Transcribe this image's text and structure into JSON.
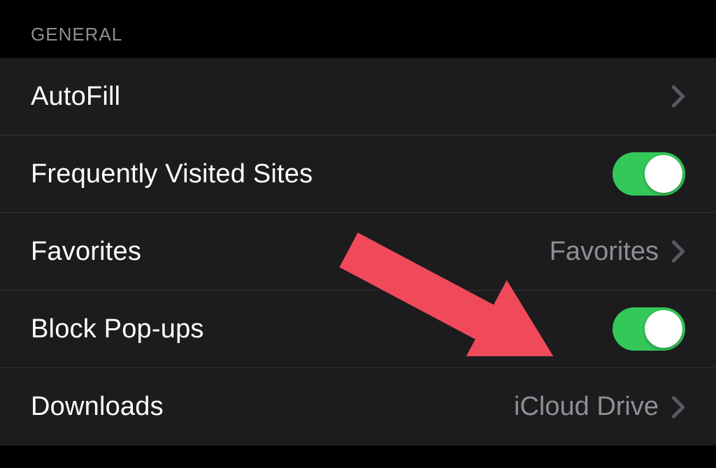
{
  "section": {
    "header": "General"
  },
  "rows": {
    "autofill": {
      "label": "AutoFill",
      "type": "nav"
    },
    "frequently_visited": {
      "label": "Frequently Visited Sites",
      "type": "toggle",
      "toggle_on": true
    },
    "favorites": {
      "label": "Favorites",
      "type": "nav",
      "value": "Favorites"
    },
    "block_popups": {
      "label": "Block Pop-ups",
      "type": "toggle",
      "toggle_on": true
    },
    "downloads": {
      "label": "Downloads",
      "type": "nav",
      "value": "iCloud Drive"
    }
  },
  "colors": {
    "toggle_on": "#34c759",
    "arrow": "#f04a5a"
  },
  "annotation": {
    "arrow_target": "block_popups_toggle"
  }
}
